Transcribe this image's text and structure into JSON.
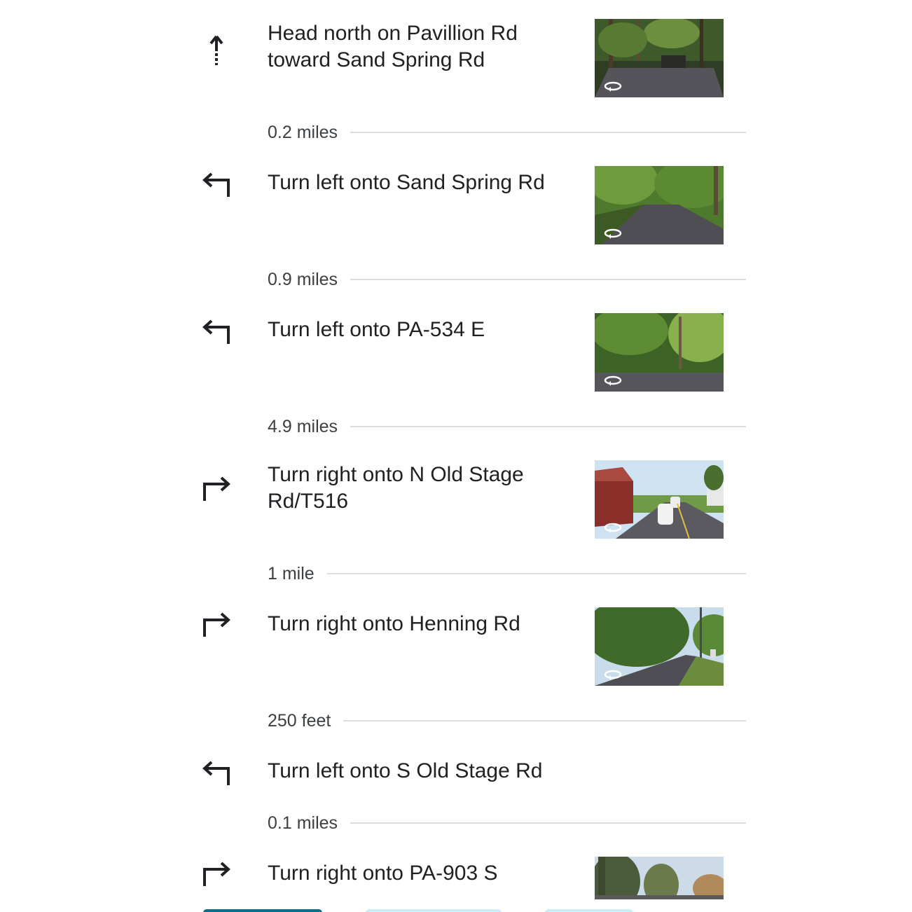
{
  "steps": [
    {
      "icon": "straight-arrow-icon",
      "instruction": "Head north on Pavillion Rd toward Sand Spring Rd",
      "has_thumbnail": true
    },
    {
      "icon": "turn-left-icon",
      "instruction": "Turn left onto Sand Spring Rd",
      "has_thumbnail": true
    },
    {
      "icon": "turn-left-icon",
      "instruction": "Turn left onto PA-534 E",
      "has_thumbnail": true
    },
    {
      "icon": "turn-right-icon",
      "instruction": "Turn right onto N Old Stage Rd/T516",
      "has_thumbnail": true
    },
    {
      "icon": "turn-right-icon",
      "instruction": "Turn right onto Henning Rd",
      "has_thumbnail": true
    },
    {
      "icon": "turn-left-icon",
      "instruction": "Turn left onto S Old Stage Rd",
      "has_thumbnail": false
    },
    {
      "icon": "turn-right-icon",
      "instruction": "Turn right onto PA-903 S",
      "has_thumbnail": true
    }
  ],
  "distances": [
    "0.2 miles",
    "0.9 miles",
    "4.9 miles",
    "1 mile",
    "250 feet",
    "0.1 miles"
  ],
  "colors": {
    "text": "#202124",
    "secondary_text": "#3c4043",
    "divider": "#dadce0",
    "icon": "#202124"
  }
}
